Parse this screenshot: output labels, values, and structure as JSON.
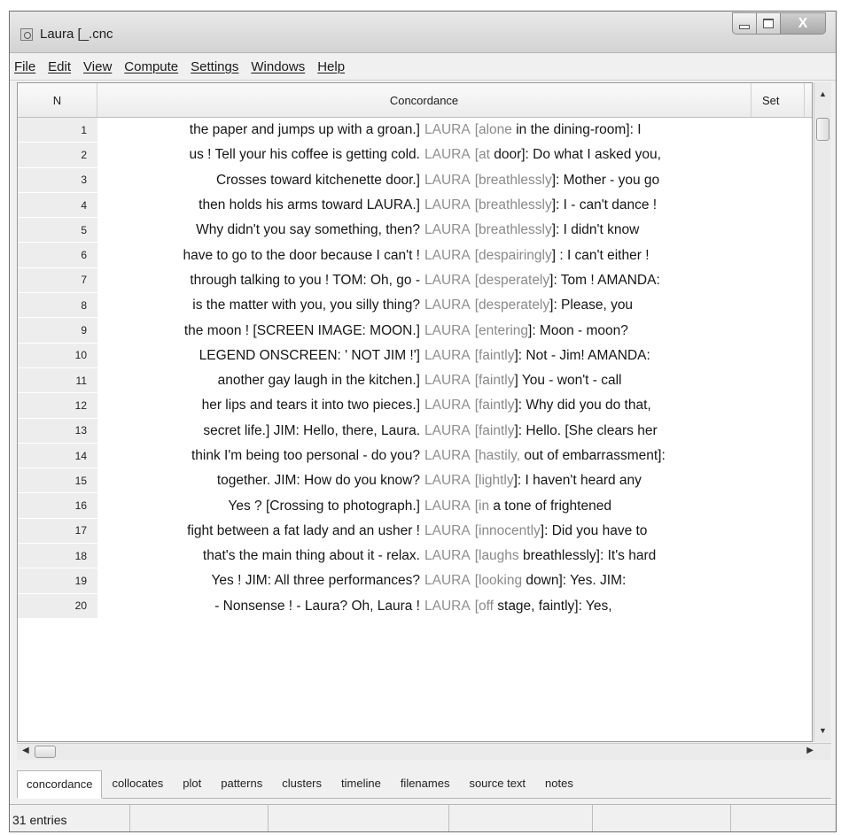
{
  "window": {
    "title": "Laura [_.cnc",
    "close_glyph": "X"
  },
  "menu": [
    "File",
    "Edit",
    "View",
    "Compute",
    "Settings",
    "Windows",
    "Help"
  ],
  "columns": {
    "n": "N",
    "concordance": "Concordance",
    "set": "Set"
  },
  "rows": [
    {
      "n": "1",
      "left": "the paper and jumps up with a groan.]",
      "hit": "LAURA",
      "right": "[alone in the dining-room]: I"
    },
    {
      "n": "2",
      "left": "us ! Tell your his coffee is getting cold.",
      "hit": "LAURA",
      "right": "[at door]: Do what I asked you,"
    },
    {
      "n": "3",
      "left": "Crosses toward kitchenette door.]",
      "hit": "LAURA",
      "right": "[breathlessly]: Mother - you go"
    },
    {
      "n": "4",
      "left": "then holds his arms toward LAURA.]",
      "hit": "LAURA",
      "right": "[breathlessly]: I - can't dance !"
    },
    {
      "n": "5",
      "left": "Why didn't you say something, then?",
      "hit": "LAURA",
      "right": "[breathlessly]: I didn't know"
    },
    {
      "n": "6",
      "left": "have to go to the door because I can't !",
      "hit": "LAURA",
      "right": "[despairingly] : I can't either !"
    },
    {
      "n": "7",
      "left": "through talking to you ! TOM: Oh, go -",
      "hit": "LAURA",
      "right": "[desperately]: Tom ! AMANDA:"
    },
    {
      "n": "8",
      "left": "is the matter with you, you silly thing?",
      "hit": "LAURA",
      "right": "[desperately]: Please, you"
    },
    {
      "n": "9",
      "left": "the moon ! [SCREEN IMAGE: MOON.]",
      "hit": "LAURA",
      "right": "[entering]: Moon - moon?"
    },
    {
      "n": "10",
      "left": "LEGEND ONSCREEN: ' NOT JIM !']",
      "hit": "LAURA",
      "right": "[faintly]: Not - Jim! AMANDA:"
    },
    {
      "n": "11",
      "left": "another gay laugh in the kitchen.]",
      "hit": "LAURA",
      "right": "[faintly] You - won't - call"
    },
    {
      "n": "12",
      "left": "her lips and tears it into two pieces.]",
      "hit": "LAURA",
      "right": "[faintly]: Why did you do that,"
    },
    {
      "n": "13",
      "left": "secret life.] JIM: Hello, there, Laura.",
      "hit": "LAURA",
      "right": "[faintly]: Hello. [She clears her"
    },
    {
      "n": "14",
      "left": "think I'm being too personal - do you?",
      "hit": "LAURA",
      "right": "[hastily, out of embarrassment]:"
    },
    {
      "n": "15",
      "left": "together. JIM: How do you know?",
      "hit": "LAURA",
      "right": "[lightly]: I haven't heard any"
    },
    {
      "n": "16",
      "left": "Yes ? [Crossing to photograph.]",
      "hit": "LAURA",
      "right": "[in a tone of frightened"
    },
    {
      "n": "17",
      "left": "fight between a fat lady and an usher !",
      "hit": "LAURA",
      "right": "[innocently]: Did you have to"
    },
    {
      "n": "18",
      "left": "that's the main thing about it - relax.",
      "hit": "LAURA",
      "right": "[laughs breathlessly]: It's hard"
    },
    {
      "n": "19",
      "left": "Yes ! JIM: All three performances?",
      "hit": "LAURA",
      "right": "[looking down]: Yes. JIM:"
    },
    {
      "n": "20",
      "left": "- Nonsense ! - Laura? Oh, Laura !",
      "hit": "LAURA",
      "right": "[off stage, faintly]: Yes,"
    }
  ],
  "tabs": [
    "concordance",
    "collocates",
    "plot",
    "patterns",
    "clusters",
    "timeline",
    "filenames",
    "source text",
    "notes"
  ],
  "active_tab": "concordance",
  "status": {
    "entries": "31 entries"
  },
  "icons": {
    "app": "app-icon",
    "minimize": "minimize-icon",
    "maximize": "maximize-icon",
    "close": "close-icon",
    "scroll_up": "arrow-up-icon",
    "scroll_down": "arrow-down-icon",
    "scroll_left": "arrow-left-icon",
    "scroll_right": "arrow-right-icon"
  },
  "colors": {
    "hit_text": "#8f8f8f",
    "row_number_bg": "#ededed",
    "chrome": "#f0f0f0"
  }
}
